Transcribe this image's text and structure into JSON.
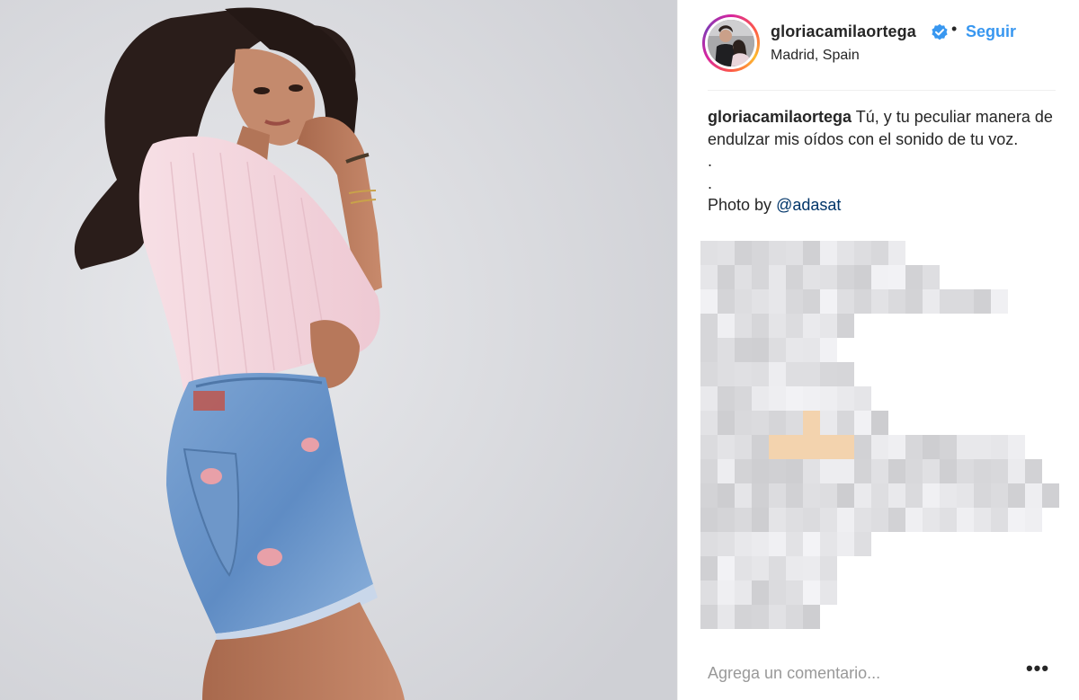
{
  "post": {
    "image_alt": "photo of a woman in a pink sweater and denim shorts",
    "header": {
      "username": "gloriacamilaortega",
      "verified_icon": "verified-badge-icon",
      "separator": "•",
      "follow_label": "Seguir",
      "location": "Madrid, Spain"
    },
    "caption": {
      "username": "gloriacamilaortega",
      "text": "Tú, y tu peculiar manera de endulzar mis oídos con el sonido de tu voz.",
      "line_dot_1": ".",
      "line_dot_2": ".",
      "photo_by": "Photo by ",
      "mention": "@adasat"
    },
    "comments_blurred": true,
    "comment_box": {
      "placeholder": "Agrega un comentario...",
      "more_label": "•••"
    }
  },
  "colors": {
    "accent": "#3897f0",
    "mention": "#003569",
    "text": "#262626",
    "muted": "#999999"
  }
}
